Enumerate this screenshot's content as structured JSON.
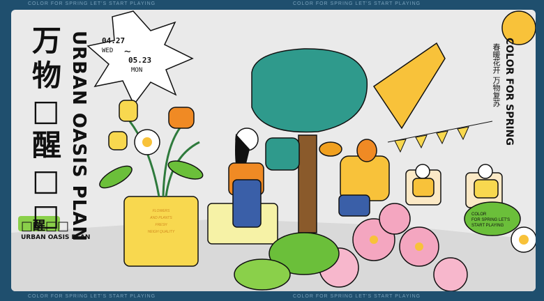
{
  "title_cn": [
    "万物",
    "□醒",
    "□□"
  ],
  "title_cn_lines": [
    "万",
    "物",
    "□",
    "醒",
    "□",
    "□"
  ],
  "vertical_en": "URBAN OASIS PLAN",
  "date_badge": {
    "start": "04.27",
    "start_day": "WED",
    "tilde": "~",
    "end": "05.23",
    "end_day": "MON"
  },
  "small_logo": {
    "cn": "□醒□□",
    "en": "URBAN OASIS PLAN"
  },
  "vase_text": [
    "FLOWERS",
    "AND PLANTS",
    "FRESH",
    "HEIGH QUALITY"
  ],
  "right_vertical_en": "COLOR FOR SPRING",
  "right_vertical_cn": "春暖花开 万物复苏",
  "color_spring_note": [
    "COLOR",
    "FOR SPRING LET'S",
    "START PLAYING"
  ],
  "edge_text": "COLOR FOR SPRING LET'S START PLAYING",
  "colors": {
    "frame": "#1f4f6e",
    "panel": "#eaeaea",
    "orange": "#f08a24",
    "yellow": "#f8d44c",
    "pink": "#f4a6c0",
    "green": "#6bbf3a",
    "teal": "#2f8a8a"
  }
}
